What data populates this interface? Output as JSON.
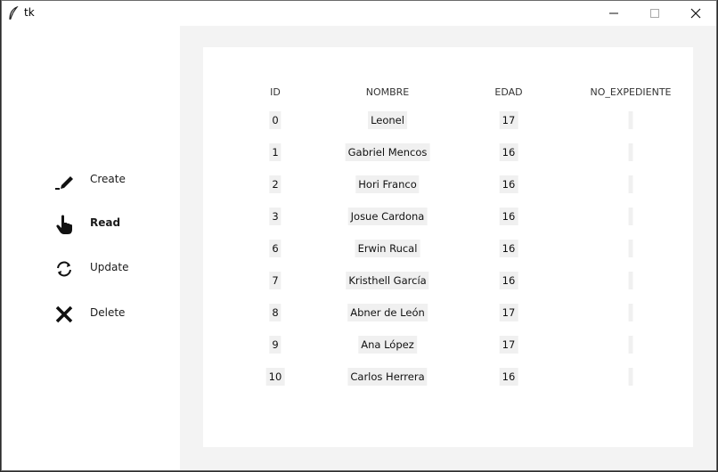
{
  "window": {
    "title": "tk"
  },
  "sidebar": {
    "items": [
      {
        "label": "Create",
        "icon": "pencil-icon",
        "selected": false
      },
      {
        "label": "Read",
        "icon": "hand-pointer-icon",
        "selected": true
      },
      {
        "label": "Update",
        "icon": "refresh-icon",
        "selected": false
      },
      {
        "label": "Delete",
        "icon": "x-icon",
        "selected": false
      }
    ]
  },
  "table": {
    "columns": [
      "ID",
      "NOMBRE",
      "EDAD",
      "NO_EXPEDIENTE"
    ],
    "rows": [
      {
        "id": "0",
        "nombre": "Leonel",
        "edad": "17",
        "no_expediente": ""
      },
      {
        "id": "1",
        "nombre": "Gabriel Mencos",
        "edad": "16",
        "no_expediente": ""
      },
      {
        "id": "2",
        "nombre": "Hori Franco",
        "edad": "16",
        "no_expediente": ""
      },
      {
        "id": "3",
        "nombre": "Josue Cardona",
        "edad": "16",
        "no_expediente": ""
      },
      {
        "id": "6",
        "nombre": "Erwin Rucal",
        "edad": "16",
        "no_expediente": ""
      },
      {
        "id": "7",
        "nombre": "Kristhell García",
        "edad": "16",
        "no_expediente": ""
      },
      {
        "id": "8",
        "nombre": "Abner de León",
        "edad": "17",
        "no_expediente": ""
      },
      {
        "id": "9",
        "nombre": "Ana López",
        "edad": "17",
        "no_expediente": ""
      },
      {
        "id": "10",
        "nombre": "Carlos Herrera",
        "edad": "16",
        "no_expediente": ""
      }
    ]
  },
  "colors": {
    "content_bg": "#f3f3f3",
    "cell_bg": "#f0f0f0",
    "panel_bg": "#ffffff"
  }
}
